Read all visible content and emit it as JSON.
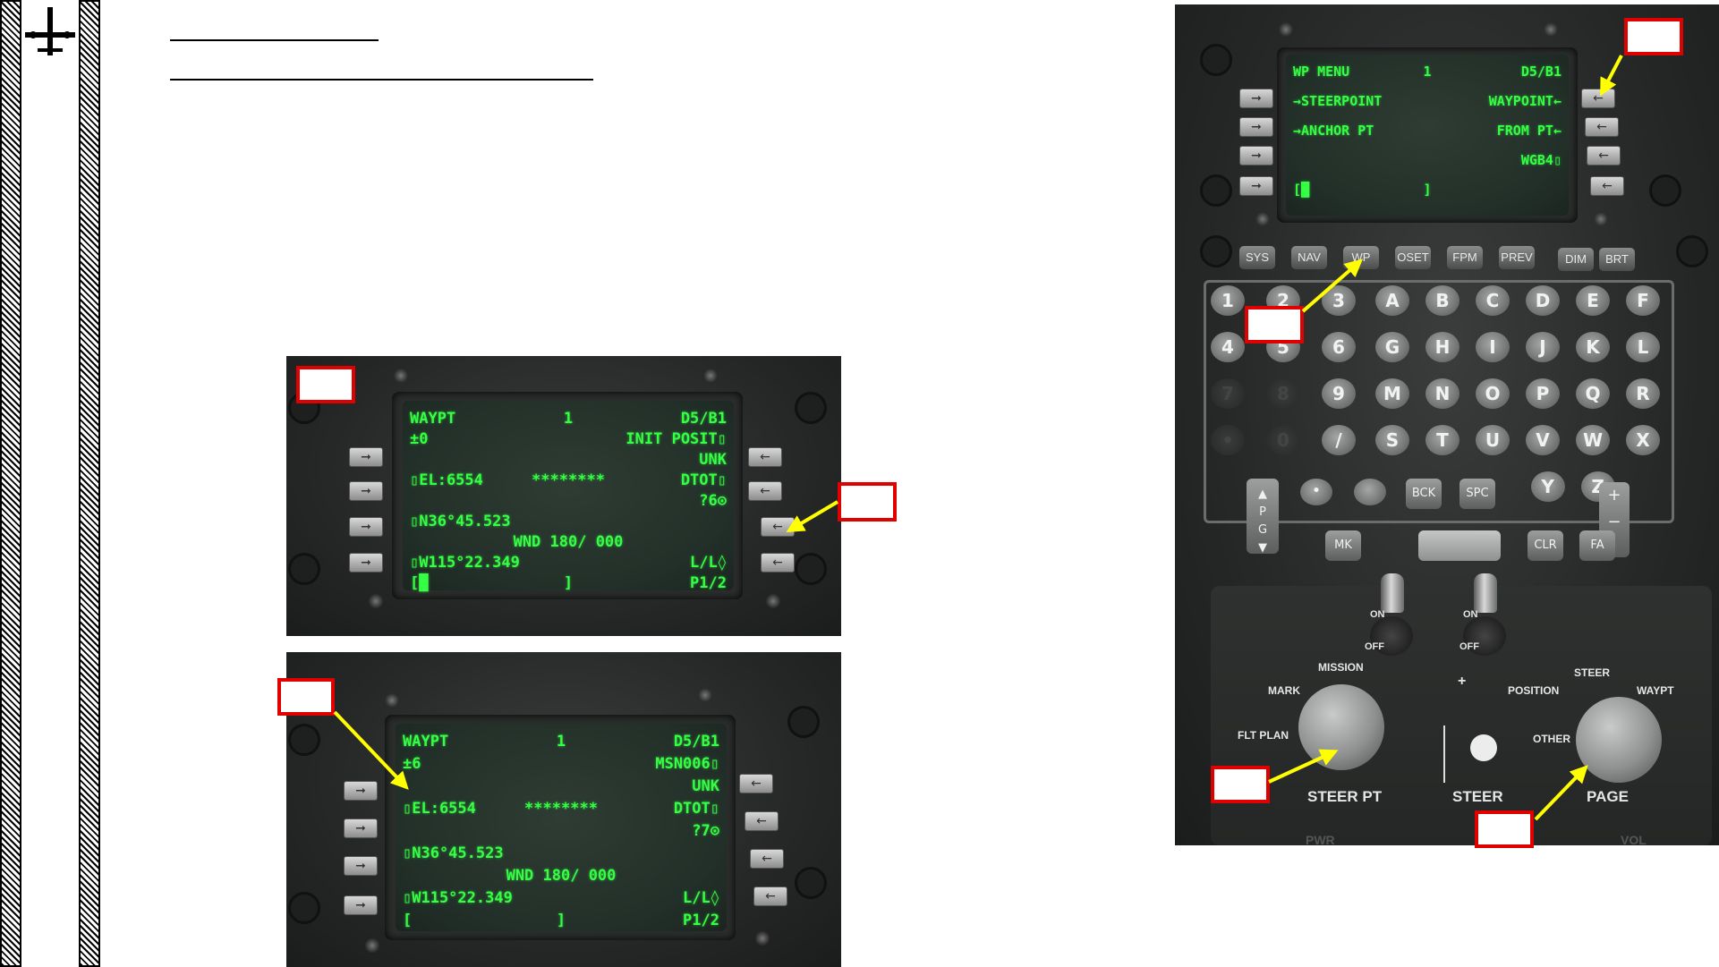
{
  "cdu_top": {
    "lines": [
      {
        "left": "WAYPT",
        "mid": "1",
        "right": "D5/B1"
      },
      {
        "left": "±0",
        "mid": "",
        "right": "INIT POSIT▯"
      },
      {
        "left": "",
        "mid": "",
        "right": "UNK"
      },
      {
        "left": "▯EL:6554",
        "mid": "********",
        "right": "DTOT▯"
      },
      {
        "left": "",
        "mid": "",
        "right": "?6⊙"
      },
      {
        "left": "▯N36°45.523",
        "mid": "",
        "right": ""
      },
      {
        "left": "",
        "mid": "WND 180/ 000",
        "right": ""
      },
      {
        "left": "▯W115°22.349",
        "mid": "",
        "right": "L/L◊"
      },
      {
        "left": "[█",
        "mid": "]",
        "right": "P1/2"
      }
    ]
  },
  "cdu_bottom": {
    "lines": [
      {
        "left": "WAYPT",
        "mid": "1",
        "right": "D5/B1"
      },
      {
        "left": "±6",
        "mid": "",
        "right": "MSN006▯"
      },
      {
        "left": "",
        "mid": "",
        "right": "UNK"
      },
      {
        "left": "▯EL:6554",
        "mid": "********",
        "right": "DTOT▯"
      },
      {
        "left": "",
        "mid": "",
        "right": "?7⊙"
      },
      {
        "left": "▯N36°45.523",
        "mid": "",
        "right": ""
      },
      {
        "left": "",
        "mid": "WND 180/ 000",
        "right": ""
      },
      {
        "left": "▯W115°22.349",
        "mid": "",
        "right": "L/L◊"
      },
      {
        "left": "[",
        "mid": "]",
        "right": "P1/2"
      }
    ]
  },
  "cdu_wp_menu": {
    "lines": [
      {
        "left": "WP MENU",
        "mid": "1",
        "right": "D5/B1"
      },
      {
        "left": "→STEERPOINT",
        "mid": "",
        "right": "WAYPOINT←"
      },
      {
        "left": "→ANCHOR PT",
        "mid": "",
        "right": "FROM PT←"
      },
      {
        "left": "",
        "mid": "",
        "right": "WGB4▯"
      },
      {
        "left": "[█",
        "mid": "]",
        "right": ""
      }
    ]
  },
  "function_keys": [
    "SYS",
    "NAV",
    "WP",
    "OSET",
    "FPM",
    "PREV",
    "DIM",
    "BRT"
  ],
  "number_keys": [
    "1",
    "2",
    "3",
    "4",
    "5",
    "6",
    "7",
    "8",
    "9",
    "•",
    "0",
    "/"
  ],
  "letter_keys": [
    "A",
    "B",
    "C",
    "D",
    "E",
    "F",
    "G",
    "H",
    "I",
    "J",
    "K",
    "L",
    "M",
    "N",
    "O",
    "P",
    "Q",
    "R",
    "S",
    "T",
    "U",
    "V",
    "W",
    "X",
    "Y",
    "Z"
  ],
  "misc_keys": {
    "bck": "BCK",
    "spc": "SPC",
    "mk": "MK",
    "clr": "CLR",
    "fa": "FA",
    "plus": "+",
    "minus": "−",
    "p": "P",
    "g": "G"
  },
  "panel_labels": {
    "on1": "ON",
    "off1": "OFF",
    "on2": "ON",
    "off2": "OFF",
    "mission": "MISSION",
    "mark": "MARK",
    "flt_plan": "FLT PLAN",
    "steer_pt": "STEER PT",
    "steer": "STEER",
    "position": "POSITION",
    "steer2": "STEER",
    "waypt": "WAYPT",
    "other": "OTHER",
    "page": "PAGE",
    "pwr": "PWR",
    "vol": "VOL",
    "plus": "+"
  },
  "colors": {
    "cdu_text": "#34ff44",
    "callout_box": "#e00000",
    "arrow": "#ffff00"
  }
}
